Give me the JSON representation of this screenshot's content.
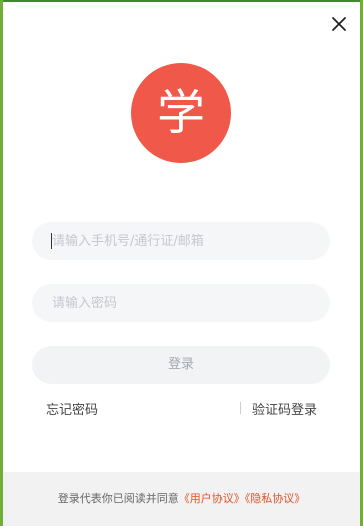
{
  "window": {
    "close_icon": "close-icon",
    "frame_color": "#6fae3a"
  },
  "logo": {
    "glyph": "学",
    "background": "#f0594a"
  },
  "form": {
    "account_placeholder": "请输入手机号/通行证/邮箱",
    "password_placeholder": "请输入密码",
    "login_label": "登录"
  },
  "links": {
    "forgot_password": "忘记密码",
    "sms_login": "验证码登录"
  },
  "footer": {
    "agreement_prefix": "登录代表你已阅读并同意",
    "user_agreement": "《用户协议》",
    "privacy_policy": "《隐私协议》",
    "accent": "#e0532a"
  }
}
